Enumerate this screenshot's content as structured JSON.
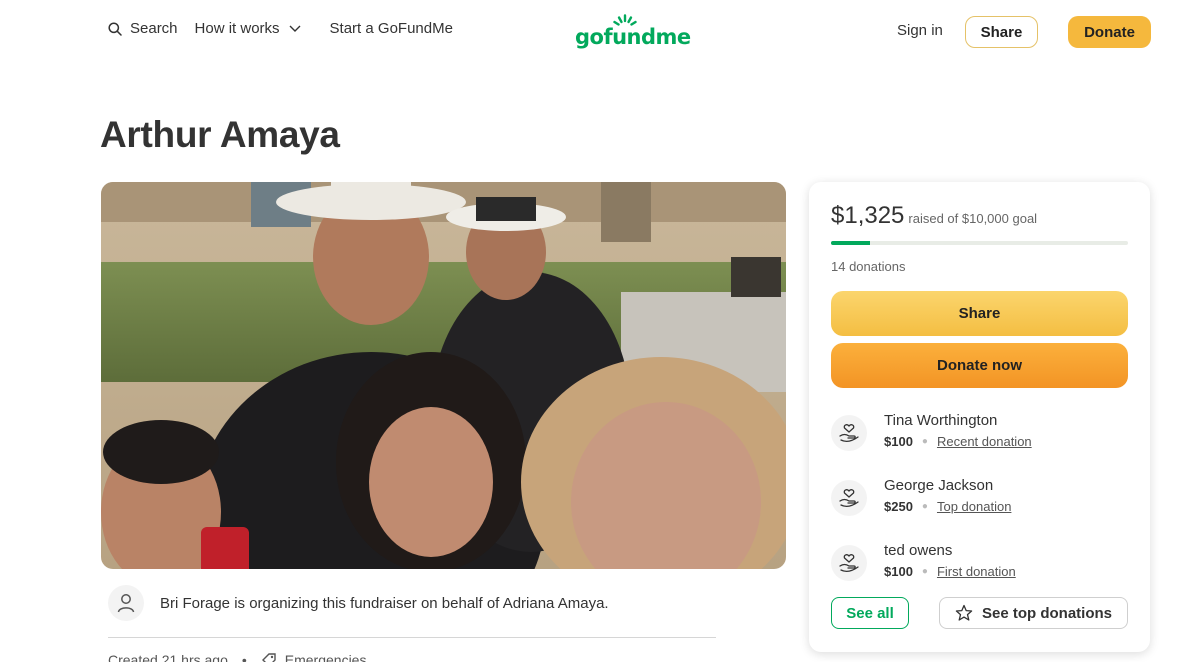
{
  "header": {
    "search_label": "Search",
    "how_label": "How it works",
    "start_label": "Start a GoFundMe",
    "logo_text": "gofundme",
    "signin_label": "Sign in",
    "share_label": "Share",
    "donate_label": "Donate"
  },
  "page": {
    "title": "Arthur Amaya"
  },
  "organizer": {
    "text": "Bri Forage is organizing this fundraiser on behalf of Adriana Amaya."
  },
  "meta": {
    "created": "Created 21 hrs ago",
    "separator": "•",
    "category": "Emergencies"
  },
  "card": {
    "raised_amount": "$1,325",
    "raised_goal": "raised of $10,000 goal",
    "progress_fraction": 0.1325,
    "donation_count": "14 donations",
    "share_label": "Share",
    "donate_label": "Donate now",
    "donations": [
      {
        "name": "Tina Worthington",
        "amount": "$100",
        "type": "Recent donation"
      },
      {
        "name": "George Jackson",
        "amount": "$250",
        "type": "Top donation"
      },
      {
        "name": "ted owens",
        "amount": "$100",
        "type": "First donation"
      }
    ],
    "see_all_label": "See all",
    "see_top_label": "See top donations"
  },
  "colors": {
    "brand_green": "#02a95c",
    "share_yellow": "#f5c04a",
    "donate_orange": "#f49b2a"
  },
  "icons": [
    "search-icon",
    "chevron-down-icon",
    "user-icon",
    "tag-icon",
    "heart-hand-icon",
    "star-icon"
  ]
}
